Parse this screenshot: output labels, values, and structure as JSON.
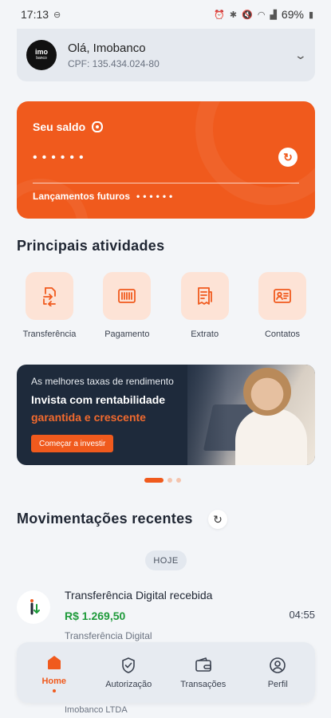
{
  "status_bar": {
    "time": "17:13",
    "battery": "69%"
  },
  "account": {
    "logo_text": "imo",
    "logo_sub": "banco",
    "greeting": "Olá, Imobanco",
    "cpf": "CPF: 135.434.024-80"
  },
  "balance": {
    "label": "Seu saldo",
    "masked_value": "••••••",
    "future_label": "Lançamentos futuros",
    "future_masked": "••••••",
    "accent_color": "#f05a1d"
  },
  "activities": {
    "title": "Principais atividades",
    "items": [
      {
        "label": "Transferência",
        "icon": "transfer-icon"
      },
      {
        "label": "Pagamento",
        "icon": "barcode-icon"
      },
      {
        "label": "Extrato",
        "icon": "receipt-icon"
      },
      {
        "label": "Contatos",
        "icon": "contact-card-icon"
      }
    ]
  },
  "banner": {
    "small": "As melhores taxas de rendimento",
    "main": "Invista com rentabilidade",
    "accent": "garantida e crescente",
    "button": "Começar a investir"
  },
  "recent": {
    "title": "Movimentações recentes",
    "day_label": "HOJE",
    "transactions": [
      {
        "title": "Transferência Digital recebida",
        "amount": "R$ 1.269,50",
        "time": "04:55",
        "subtitle": "Transferência Digital",
        "counterparty": "Imobanco LTDA"
      }
    ]
  },
  "nav": {
    "items": [
      {
        "label": "Home",
        "active": true
      },
      {
        "label": "Autorização"
      },
      {
        "label": "Transações"
      },
      {
        "label": "Perfil"
      }
    ]
  }
}
